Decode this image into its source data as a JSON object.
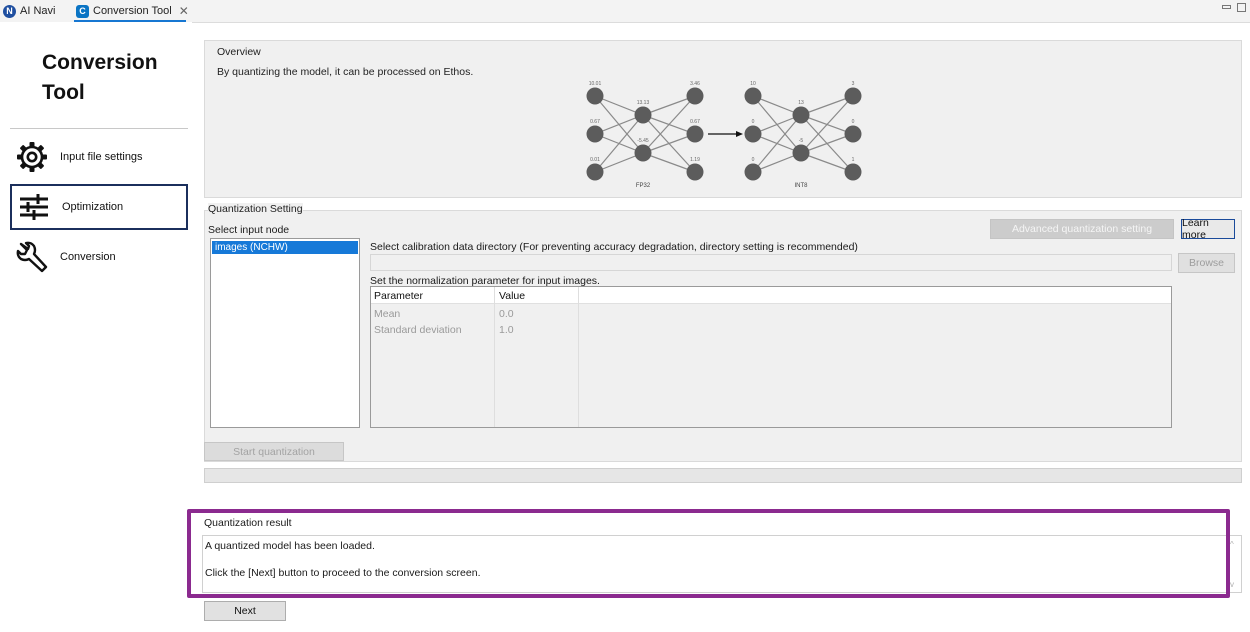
{
  "tabs": [
    {
      "label": "AI Navi",
      "icon": "ai-navi-icon"
    },
    {
      "label": "Conversion Tool",
      "icon": "conversion-tool-icon",
      "close": "✕",
      "active": true
    }
  ],
  "sidebar": {
    "title": "Conversion\nTool",
    "items": [
      {
        "label": "Input file settings",
        "icon": "gear-icon"
      },
      {
        "label": "Optimization",
        "icon": "sliders-icon",
        "selected": true
      },
      {
        "label": "Conversion",
        "icon": "wrench-icon"
      }
    ]
  },
  "overview": {
    "label": "Overview",
    "text": "By quantizing the model, it can be processed on Ethos.",
    "diagram": {
      "fp32": {
        "caption": "FP32",
        "inputs": [
          "10.01",
          "0.67",
          "0.01"
        ],
        "hidden": [
          "13.13",
          "-5.45"
        ],
        "outputs": [
          "3.46",
          "0.67",
          "1.19"
        ]
      },
      "int8": {
        "caption": "INT8",
        "inputs": [
          "10",
          "0",
          "0"
        ],
        "hidden": [
          "13",
          "-5"
        ],
        "outputs": [
          "3",
          "0",
          "1"
        ]
      }
    }
  },
  "quantization_setting": {
    "label": "Quantization Setting",
    "select_input_node_label": "Select input node",
    "selected_node": "images (NCHW)",
    "advanced_button": "Advanced quantization setting",
    "learn_more_button": "Learn more",
    "calibration_label": "Select calibration data directory (For preventing accuracy degradation, directory setting is recommended)",
    "calibration_value": "",
    "browse_button": "Browse",
    "normalization_label": "Set the normalization parameter for input images.",
    "table": {
      "headers": [
        "Parameter",
        "Value"
      ],
      "rows": [
        {
          "parameter": "Mean",
          "value": "0.0"
        },
        {
          "parameter": "Standard deviation",
          "value": "1.0"
        }
      ]
    }
  },
  "start_quantization_button": "Start quantization",
  "quantization_result": {
    "label": "Quantization result",
    "line1": "A quantized model has been loaded.",
    "line2": "Click the [Next] button to proceed to the conversion screen."
  },
  "next_button": "Next",
  "colors": {
    "highlight": "#8b2a8f",
    "selection": "#1679d8",
    "nav_selected_border": "#1b2f5c"
  }
}
